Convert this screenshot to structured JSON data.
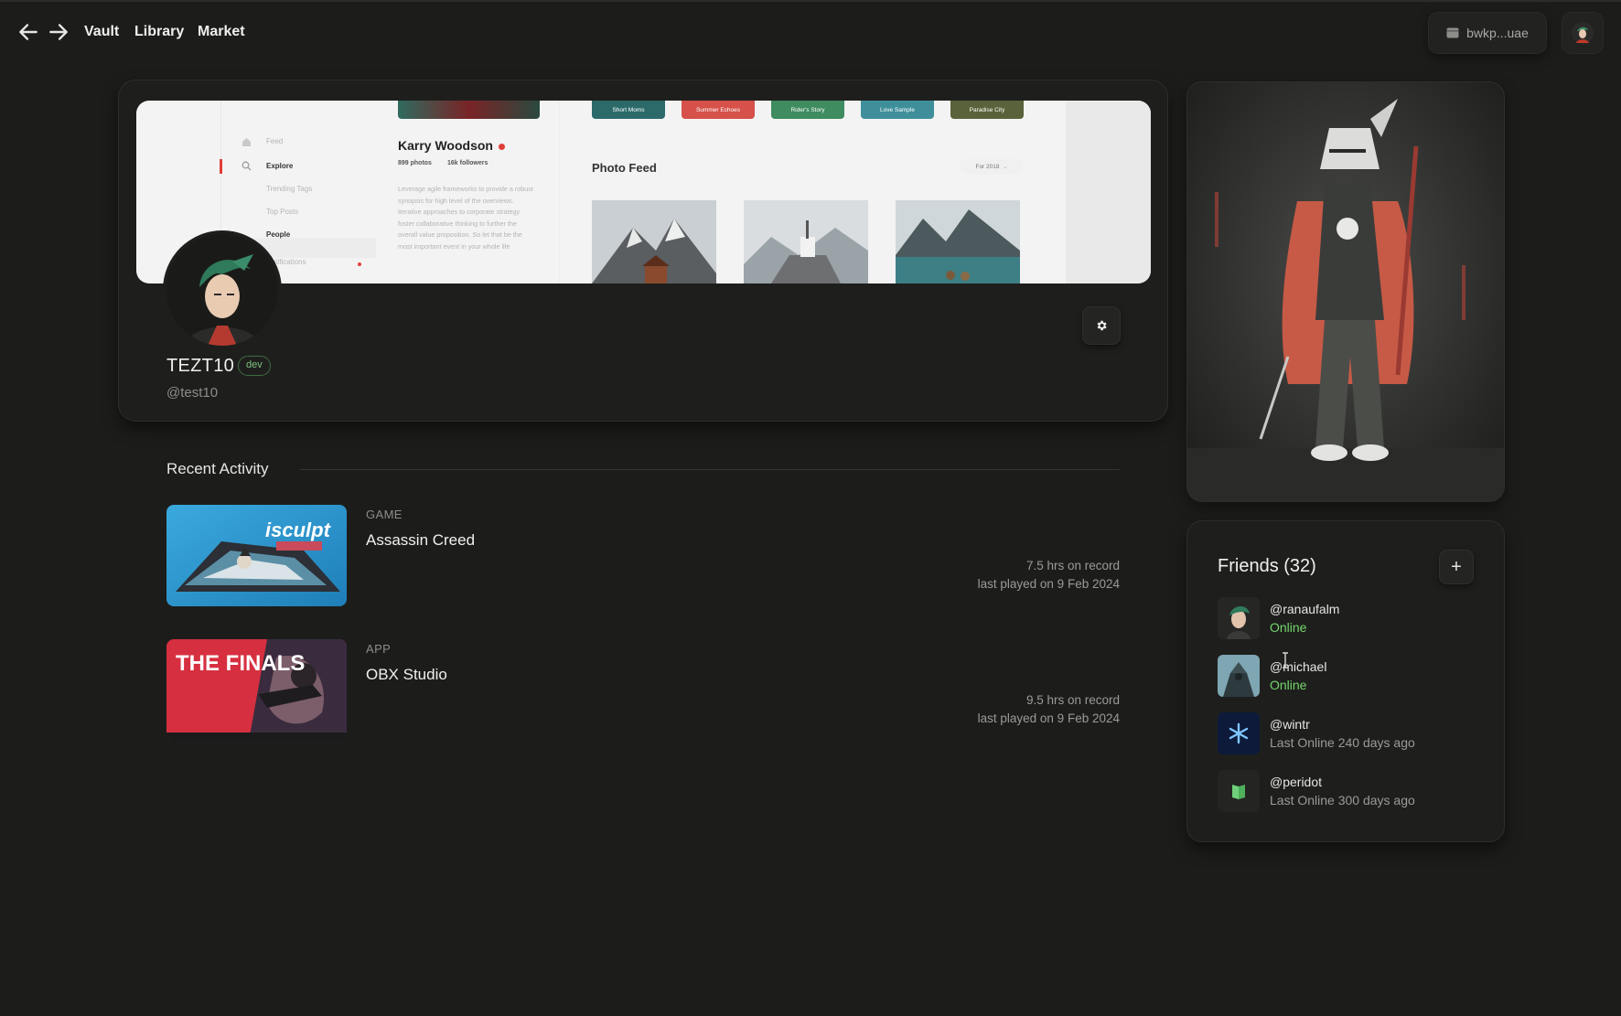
{
  "nav": {
    "back_icon": "arrow-left-icon",
    "forward_icon": "arrow-right-icon",
    "links": [
      "Vault",
      "Library",
      "Market"
    ],
    "wallet_label": "bwkp...uae",
    "wallet_icon": "wallet-icon"
  },
  "banner": {
    "sidebar_items": [
      "Feed",
      "Explore",
      "Trending Tags",
      "Top Posts",
      "People",
      "Notifications"
    ],
    "profile_name": "Karry Woodson",
    "photos": "899 photos",
    "followers": "16k followers",
    "bio": "Leverage agile frameworks to provide a robust synopsis for high level of the overviews. Iterative approaches to corporate strategy foster collaborative thinking to further the overall value proposition. So let that be the most important event in your whole life",
    "chips": [
      "Short Moms",
      "Summer Echoes",
      "Rider's Story",
      "Love Sample",
      "Paradise City"
    ],
    "feed_title": "Photo Feed",
    "feed_filter": "For 2018"
  },
  "profile": {
    "username": "TEZT10",
    "badge": "dev",
    "handle": "@test10",
    "settings_icon": "gear-icon"
  },
  "activity": {
    "title": "Recent Activity",
    "items": [
      {
        "kind": "GAME",
        "name": "Assassin Creed",
        "hours": "7.5 hrs on record",
        "last": "last played on 9 Feb 2024",
        "art_text": "isculpt"
      },
      {
        "kind": "APP",
        "name": "OBX Studio",
        "hours": "9.5 hrs on record",
        "last": "last played on 9 Feb 2024",
        "art_text": "THE FINALS"
      }
    ]
  },
  "friends": {
    "title": "Friends (32)",
    "add_label": "+",
    "list": [
      {
        "handle": "@ranaufalm",
        "status": "Online",
        "online": true
      },
      {
        "handle": "@michael",
        "status": "Online",
        "online": true
      },
      {
        "handle": "@wintr",
        "status": "Last Online 240 days ago",
        "online": false
      },
      {
        "handle": "@peridot",
        "status": "Last Online 300 days ago",
        "online": false
      }
    ]
  },
  "colors": {
    "background": "#1c1d1b",
    "card": "#1e1f1d",
    "online": "#74d46b",
    "badge": "#7fc27f"
  }
}
